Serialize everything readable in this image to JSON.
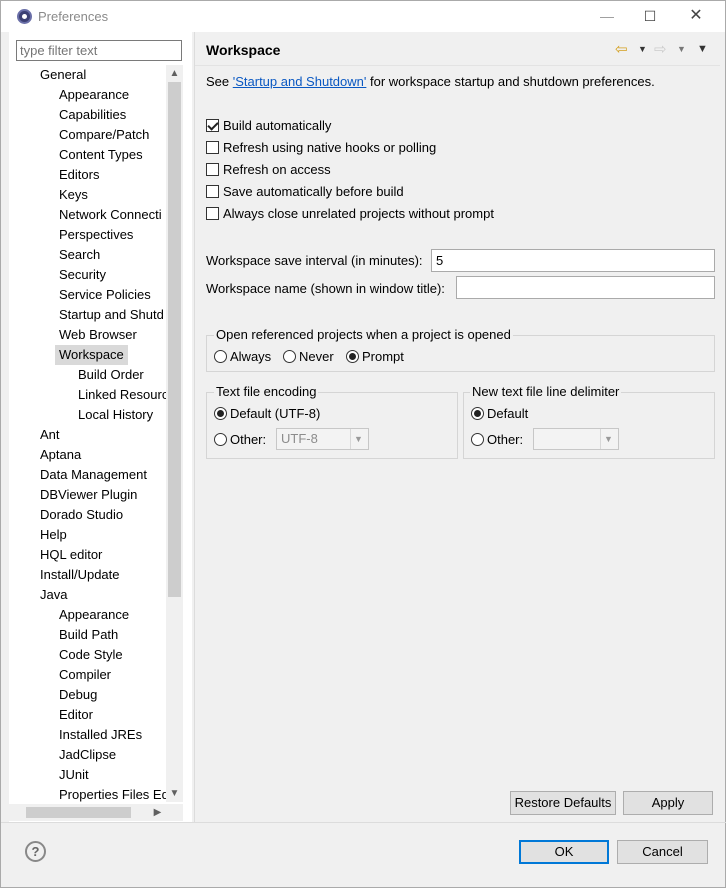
{
  "window": {
    "title": "Preferences",
    "controls": {
      "minimize": "—",
      "maximize": "☐",
      "close": "✕"
    }
  },
  "sidebar": {
    "filter_placeholder": "type filter text",
    "tree": [
      {
        "label": "General",
        "level": 0
      },
      {
        "label": "Appearance",
        "level": 1
      },
      {
        "label": "Capabilities",
        "level": 1
      },
      {
        "label": "Compare/Patch",
        "level": 1
      },
      {
        "label": "Content Types",
        "level": 1
      },
      {
        "label": "Editors",
        "level": 1
      },
      {
        "label": "Keys",
        "level": 1
      },
      {
        "label": "Network Connecti",
        "level": 1
      },
      {
        "label": "Perspectives",
        "level": 1
      },
      {
        "label": "Search",
        "level": 1
      },
      {
        "label": "Security",
        "level": 1
      },
      {
        "label": "Service Policies",
        "level": 1
      },
      {
        "label": "Startup and Shutd",
        "level": 1
      },
      {
        "label": "Web Browser",
        "level": 1
      },
      {
        "label": "Workspace",
        "level": 1,
        "selected": true
      },
      {
        "label": "Build Order",
        "level": 2
      },
      {
        "label": "Linked Resourc",
        "level": 2
      },
      {
        "label": "Local History",
        "level": 2
      },
      {
        "label": "Ant",
        "level": 0
      },
      {
        "label": "Aptana",
        "level": 0
      },
      {
        "label": "Data Management",
        "level": 0
      },
      {
        "label": "DBViewer Plugin",
        "level": 0
      },
      {
        "label": "Dorado Studio",
        "level": 0
      },
      {
        "label": "Help",
        "level": 0
      },
      {
        "label": "HQL editor",
        "level": 0
      },
      {
        "label": "Install/Update",
        "level": 0
      },
      {
        "label": "Java",
        "level": 0
      },
      {
        "label": "Appearance",
        "level": 1
      },
      {
        "label": "Build Path",
        "level": 1
      },
      {
        "label": "Code Style",
        "level": 1
      },
      {
        "label": "Compiler",
        "level": 1
      },
      {
        "label": "Debug",
        "level": 1
      },
      {
        "label": "Editor",
        "level": 1
      },
      {
        "label": "Installed JREs",
        "level": 1
      },
      {
        "label": "JadClipse",
        "level": 1
      },
      {
        "label": "JUnit",
        "level": 1
      },
      {
        "label": "Properties Files Ed",
        "level": 1
      }
    ]
  },
  "main": {
    "title": "Workspace",
    "icons": {
      "back": "⇦",
      "back_menu": "▼",
      "forward": "⇨",
      "forward_menu": "▼",
      "view_menu": "▼"
    },
    "see_prefix": "See ",
    "see_link": "'Startup and Shutdown'",
    "see_suffix": " for workspace startup and shutdown preferences.",
    "checkboxes": [
      {
        "label": "Build automatically",
        "checked": true
      },
      {
        "label": "Refresh using native hooks or polling",
        "checked": false
      },
      {
        "label": "Refresh on access",
        "checked": false
      },
      {
        "label": "Save automatically before build",
        "checked": false
      },
      {
        "label": "Always close unrelated projects without prompt",
        "checked": false
      }
    ],
    "save_interval_label": "Workspace save interval (in minutes):",
    "save_interval_value": "5",
    "workspace_name_label": "Workspace name (shown in window title):",
    "workspace_name_value": "",
    "open_ref": {
      "title": "Open referenced projects when a project is opened",
      "options": [
        "Always",
        "Never",
        "Prompt"
      ],
      "selected": "Prompt"
    },
    "encoding": {
      "title": "Text file encoding",
      "default_label": "Default (UTF-8)",
      "other_label": "Other:",
      "other_value": "UTF-8",
      "selected": "default"
    },
    "line_delimiter": {
      "title": "New text file line delimiter",
      "default_label": "Default",
      "other_label": "Other:",
      "other_value": "",
      "selected": "default"
    },
    "restore_defaults": "Restore Defaults",
    "apply": "Apply"
  },
  "footer": {
    "help_icon": "?",
    "ok": "OK",
    "cancel": "Cancel"
  }
}
